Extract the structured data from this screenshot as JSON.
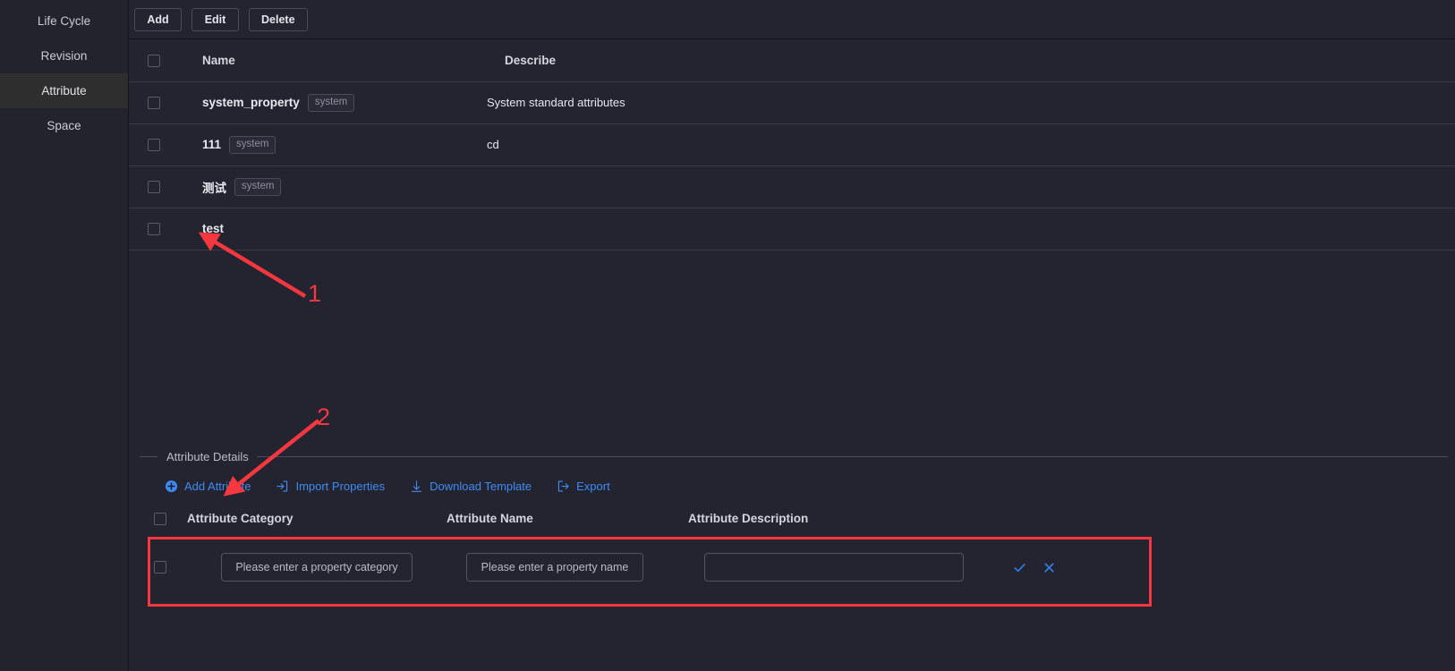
{
  "sidebar": {
    "items": [
      {
        "label": "Life Cycle",
        "active": false
      },
      {
        "label": "Revision",
        "active": false
      },
      {
        "label": "Attribute",
        "active": true
      },
      {
        "label": "Space",
        "active": false
      }
    ]
  },
  "toolbar": {
    "add_label": "Add",
    "edit_label": "Edit",
    "delete_label": "Delete"
  },
  "main_table": {
    "columns": [
      "Name",
      "Describe"
    ],
    "rows": [
      {
        "name": "system_property",
        "tag": "system",
        "describe": "System standard attributes"
      },
      {
        "name": "111",
        "tag": "system",
        "describe": "cd"
      },
      {
        "name": "测试",
        "tag": "system",
        "describe": ""
      },
      {
        "name": "test",
        "tag": "",
        "describe": ""
      }
    ]
  },
  "details": {
    "legend": "Attribute Details",
    "links": [
      {
        "label": "Add Attribute",
        "icon": "plus-circle-icon"
      },
      {
        "label": "Import Properties",
        "icon": "import-icon"
      },
      {
        "label": "Download Template",
        "icon": "download-icon"
      },
      {
        "label": "Export",
        "icon": "export-icon"
      }
    ],
    "columns": [
      "Attribute Category",
      "Attribute Name",
      "Attribute Description"
    ],
    "row": {
      "category_placeholder": "Please enter a property category",
      "category_value": "",
      "name_placeholder": "Please enter a property name",
      "name_value": "",
      "description_placeholder": "",
      "description_value": ""
    },
    "actions": {
      "confirm_icon": "check-icon",
      "cancel_icon": "close-icon"
    }
  },
  "annotations": {
    "marker_1": "1",
    "marker_2": "2",
    "color": "#f5383f"
  },
  "colors": {
    "background": "#242430",
    "sidebar": "#23232e",
    "accent_link": "#3d8bf2",
    "annotation_red": "#f5383f",
    "border": "#3b3b46"
  }
}
